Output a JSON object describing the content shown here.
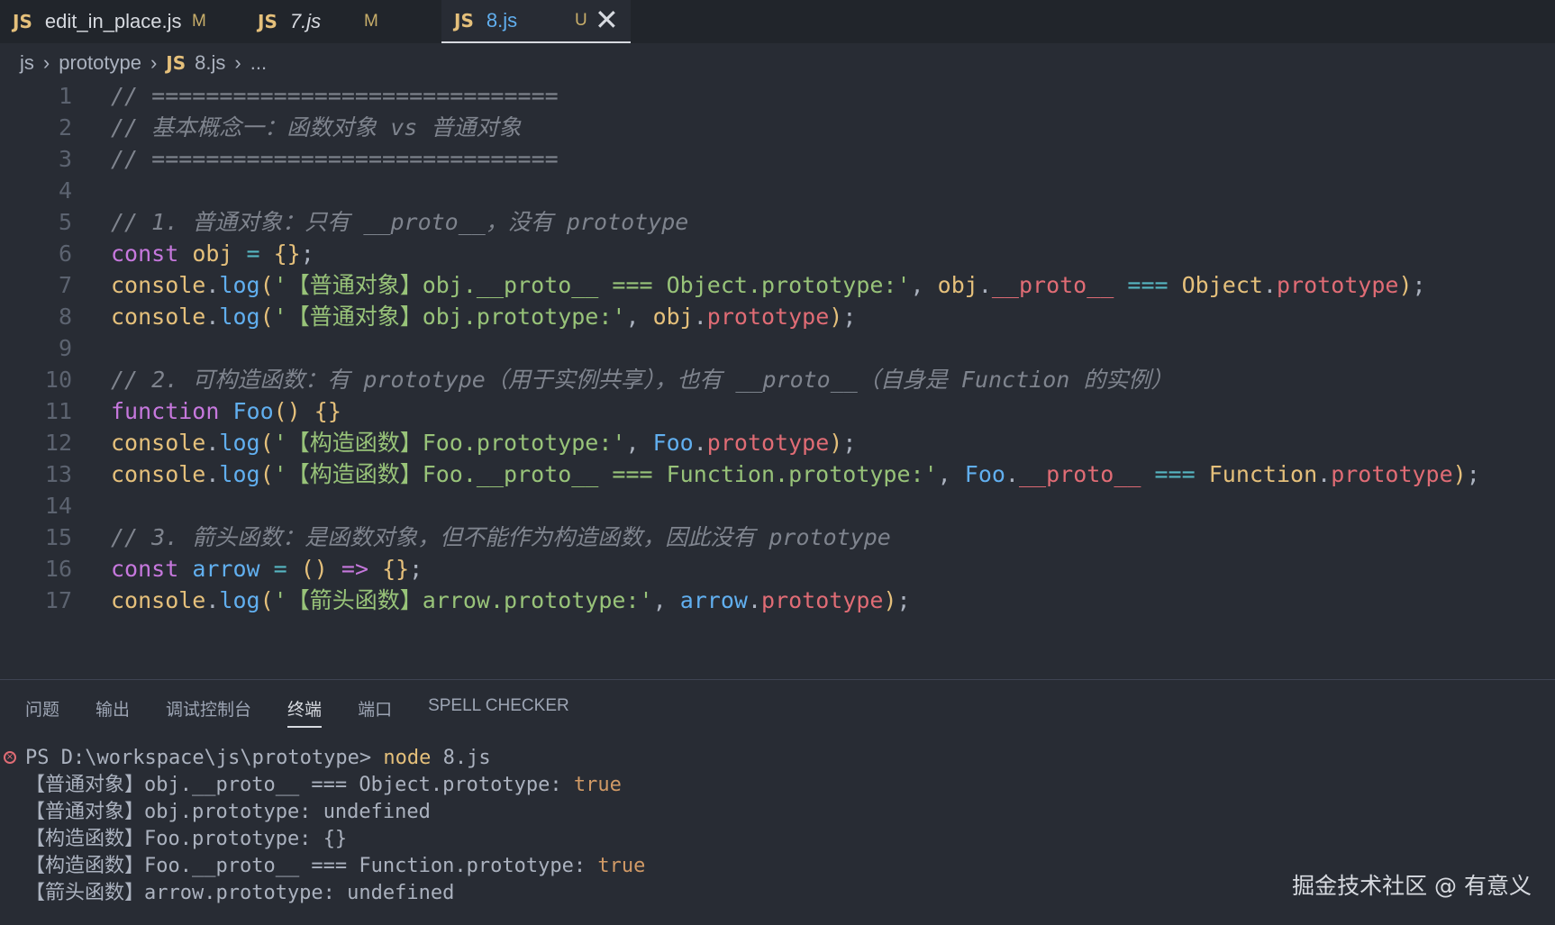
{
  "tabs": [
    {
      "icon": "JS",
      "name": "edit_in_place.js",
      "badge": "M"
    },
    {
      "icon": "JS",
      "name": "7.js",
      "badge": "M"
    },
    {
      "icon": "JS",
      "name": "8.js",
      "badge": "U",
      "close": "✕"
    }
  ],
  "breadcrumb": {
    "part1": "js",
    "part2": "prototype",
    "icon": "JS",
    "file": "8.js",
    "more": "..."
  },
  "lines": [
    {
      "n": "1",
      "t": [
        [
          "cm",
          "// =============================="
        ]
      ]
    },
    {
      "n": "2",
      "t": [
        [
          "cm",
          "// 基本概念一：函数对象 vs 普通对象"
        ]
      ]
    },
    {
      "n": "3",
      "t": [
        [
          "cm",
          "// =============================="
        ]
      ]
    },
    {
      "n": "4",
      "t": []
    },
    {
      "n": "5",
      "t": [
        [
          "cm",
          "// 1. 普通对象：只有 __proto__，没有 prototype"
        ]
      ]
    },
    {
      "n": "6",
      "t": [
        [
          "kw",
          "const "
        ],
        [
          "var",
          "obj"
        ],
        [
          "op",
          " = "
        ],
        [
          "br",
          "{}"
        ],
        [
          "pn",
          ";"
        ]
      ]
    },
    {
      "n": "7",
      "t": [
        [
          "var",
          "console"
        ],
        [
          "pn",
          "."
        ],
        [
          "fn",
          "log"
        ],
        [
          "br",
          "("
        ],
        [
          "str",
          "'【普通对象】obj.__proto__ === Object.prototype:'"
        ],
        [
          "pn",
          ", "
        ],
        [
          "var",
          "obj"
        ],
        [
          "pn",
          "."
        ],
        [
          "prop",
          "__proto__"
        ],
        [
          "op",
          " === "
        ],
        [
          "cls",
          "Object"
        ],
        [
          "pn",
          "."
        ],
        [
          "prop",
          "prototype"
        ],
        [
          "br",
          ")"
        ],
        [
          "pn",
          ";"
        ]
      ]
    },
    {
      "n": "8",
      "t": [
        [
          "var",
          "console"
        ],
        [
          "pn",
          "."
        ],
        [
          "fn",
          "log"
        ],
        [
          "br",
          "("
        ],
        [
          "str",
          "'【普通对象】obj.prototype:'"
        ],
        [
          "pn",
          ", "
        ],
        [
          "var",
          "obj"
        ],
        [
          "pn",
          "."
        ],
        [
          "prop",
          "prototype"
        ],
        [
          "br",
          ")"
        ],
        [
          "pn",
          ";"
        ]
      ]
    },
    {
      "n": "9",
      "t": []
    },
    {
      "n": "10",
      "t": [
        [
          "cm",
          "// 2. 可构造函数：有 prototype（用于实例共享），也有 __proto__（自身是 Function 的实例）"
        ]
      ]
    },
    {
      "n": "11",
      "t": [
        [
          "kw",
          "function "
        ],
        [
          "fn",
          "Foo"
        ],
        [
          "br",
          "() {}"
        ]
      ]
    },
    {
      "n": "12",
      "t": [
        [
          "var",
          "console"
        ],
        [
          "pn",
          "."
        ],
        [
          "fn",
          "log"
        ],
        [
          "br",
          "("
        ],
        [
          "str",
          "'【构造函数】Foo.prototype:'"
        ],
        [
          "pn",
          ", "
        ],
        [
          "fn",
          "Foo"
        ],
        [
          "pn",
          "."
        ],
        [
          "prop",
          "prototype"
        ],
        [
          "br",
          ")"
        ],
        [
          "pn",
          ";"
        ]
      ]
    },
    {
      "n": "13",
      "t": [
        [
          "var",
          "console"
        ],
        [
          "pn",
          "."
        ],
        [
          "fn",
          "log"
        ],
        [
          "br",
          "("
        ],
        [
          "str",
          "'【构造函数】Foo.__proto__ === Function.prototype:'"
        ],
        [
          "pn",
          ", "
        ],
        [
          "fn",
          "Foo"
        ],
        [
          "pn",
          "."
        ],
        [
          "prop",
          "__proto__"
        ],
        [
          "op",
          " === "
        ],
        [
          "cls",
          "Function"
        ],
        [
          "pn",
          "."
        ],
        [
          "prop",
          "prototype"
        ],
        [
          "br",
          ")"
        ],
        [
          "pn",
          ";"
        ]
      ]
    },
    {
      "n": "14",
      "t": []
    },
    {
      "n": "15",
      "t": [
        [
          "cm",
          "// 3. 箭头函数：是函数对象，但不能作为构造函数，因此没有 prototype"
        ]
      ]
    },
    {
      "n": "16",
      "t": [
        [
          "kw",
          "const "
        ],
        [
          "fn",
          "arrow"
        ],
        [
          "op",
          " = "
        ],
        [
          "br",
          "()"
        ],
        [
          "kw",
          " => "
        ],
        [
          "br",
          "{}"
        ],
        [
          "pn",
          ";"
        ]
      ]
    },
    {
      "n": "17",
      "t": [
        [
          "var",
          "console"
        ],
        [
          "pn",
          "."
        ],
        [
          "fn",
          "log"
        ],
        [
          "br",
          "("
        ],
        [
          "str",
          "'【箭头函数】arrow.prototype:'"
        ],
        [
          "pn",
          ", "
        ],
        [
          "fn",
          "arrow"
        ],
        [
          "pn",
          "."
        ],
        [
          "prop",
          "prototype"
        ],
        [
          "br",
          ")"
        ],
        [
          "pn",
          ";"
        ]
      ]
    }
  ],
  "panel_tabs": [
    {
      "label": "问题",
      "active": false
    },
    {
      "label": "输出",
      "active": false
    },
    {
      "label": "调试控制台",
      "active": false
    },
    {
      "label": "终端",
      "active": true
    },
    {
      "label": "端口",
      "active": false
    },
    {
      "label": "SPELL CHECKER",
      "active": false
    }
  ],
  "terminal": {
    "prompt": "PS D:\\workspace\\js\\prototype> ",
    "command": "node",
    "arg": " 8.js",
    "output": [
      {
        "text": "【普通对象】obj.__proto__ === Object.prototype: ",
        "value": "true",
        "hl": true
      },
      {
        "text": "【普通对象】obj.prototype: ",
        "value": "undefined",
        "hl": false
      },
      {
        "text": "【构造函数】Foo.prototype: ",
        "value": "{}",
        "hl": false
      },
      {
        "text": "【构造函数】Foo.__proto__ === Function.prototype: ",
        "value": "true",
        "hl": true
      },
      {
        "text": "【箭头函数】arrow.prototype: ",
        "value": "undefined",
        "hl": false
      }
    ]
  },
  "watermark": "掘金技术社区 @ 有意义"
}
